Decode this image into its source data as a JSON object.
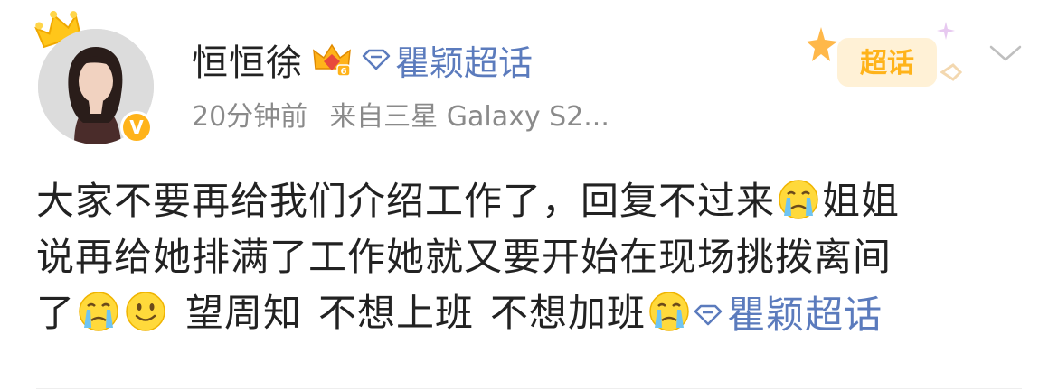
{
  "post": {
    "author": {
      "name": "恒恒徐",
      "verified_badge": "V",
      "crown_icon": "crown-icon",
      "vip_icon": "vip-crown-icon"
    },
    "header_topic": "瞿颖超话",
    "meta": {
      "time": "20分钟前",
      "source": "来自三星 Galaxy S2..."
    },
    "supertopic_badge_text": "超话",
    "content": {
      "line1_text": "大家不要再给我们介绍工作了，回复不过来",
      "line1_tail": "姐姐",
      "line2_text": "说再给她排满了工作她就又要开始在现场挑拨离间",
      "line3_start": "了",
      "line3_hashtags": [
        "望周知",
        "不想上班",
        "不想加班"
      ],
      "topic_link": "瞿颖超话"
    },
    "colors": {
      "link": "#5b7bbd",
      "meta": "#8a8a8a",
      "badge": "#ffb31a"
    }
  }
}
